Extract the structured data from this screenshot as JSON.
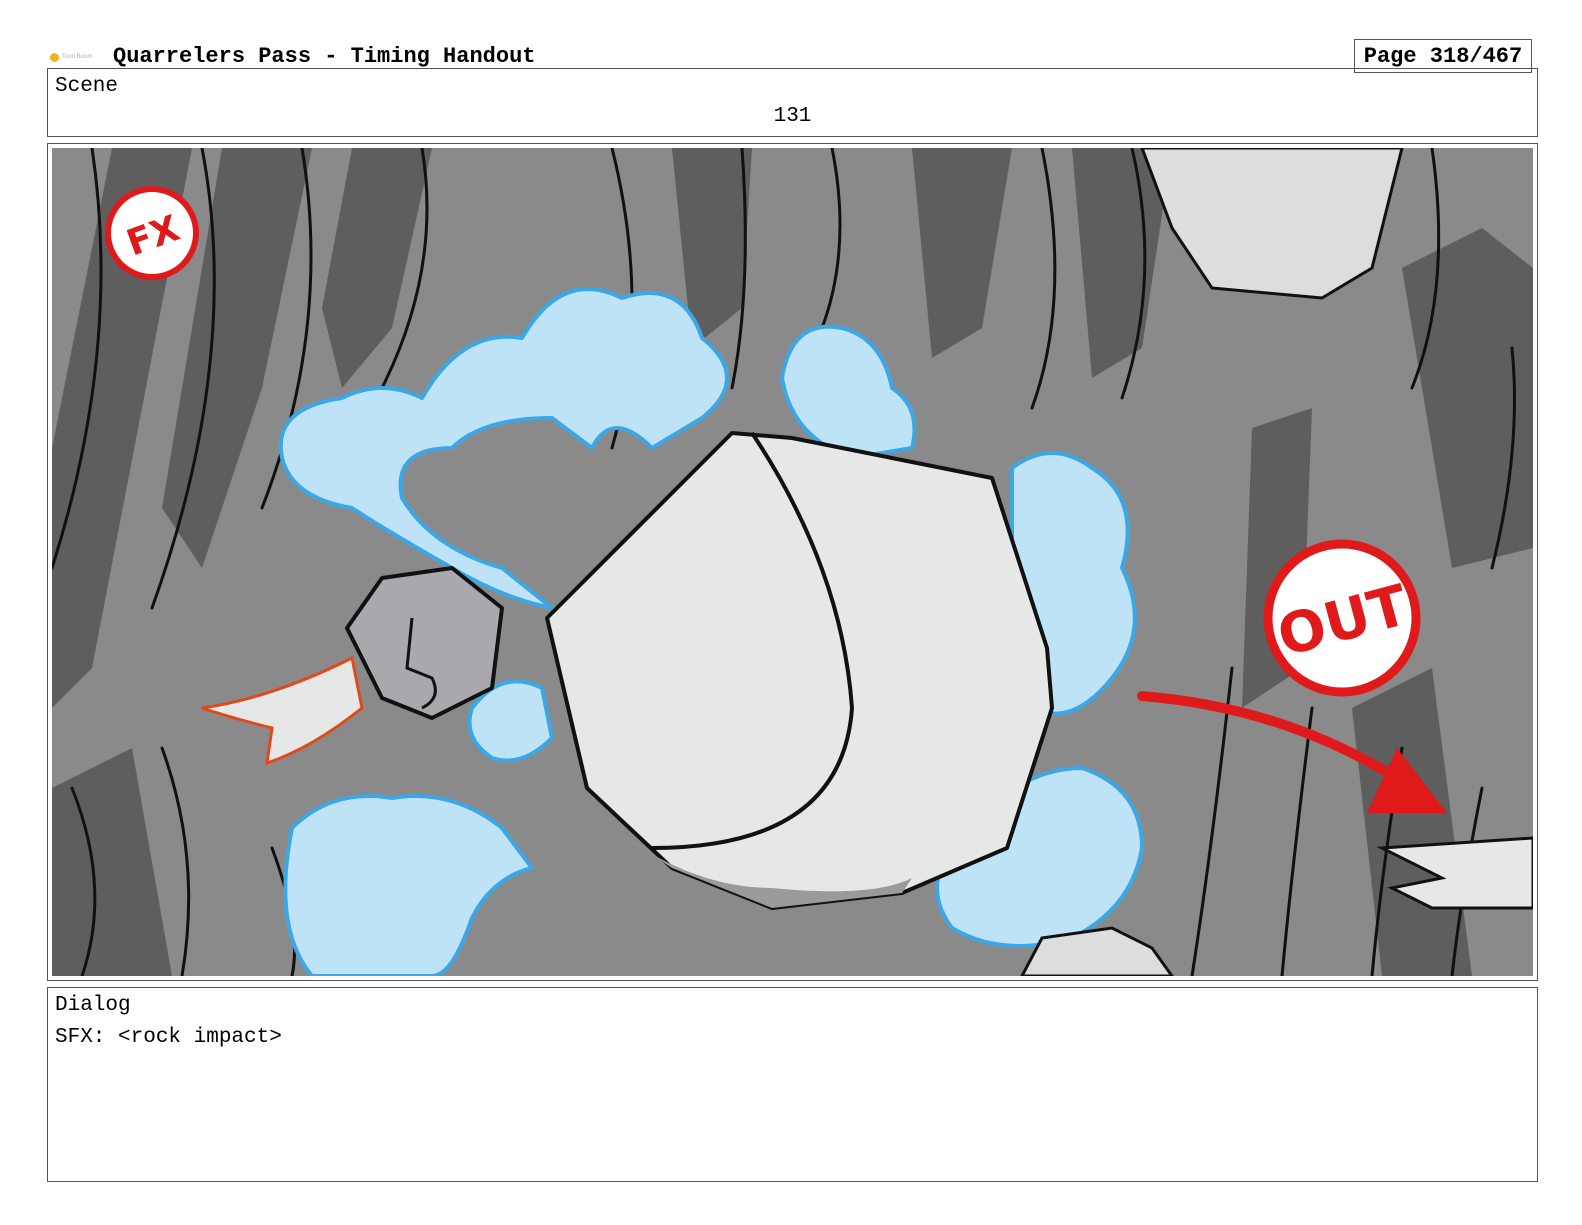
{
  "header": {
    "logo_text": "Toon Boom",
    "title": "Quarrelers Pass - Timing Handout",
    "page": "Page 318/467"
  },
  "scene": {
    "label": "Scene",
    "number": "131"
  },
  "panel": {
    "fx_badge": "FX",
    "out_badge": "OUT",
    "colors": {
      "background": "#8a8a8a",
      "dark_stripe": "#5e5e5e",
      "rock": "#e6e8e7",
      "smoke_fill": "#bfe3f6",
      "smoke_edge": "#3ba7e6",
      "accent_red": "#e01a1a"
    }
  },
  "dialog": {
    "label": "Dialog",
    "text": "SFX: <rock impact>"
  }
}
